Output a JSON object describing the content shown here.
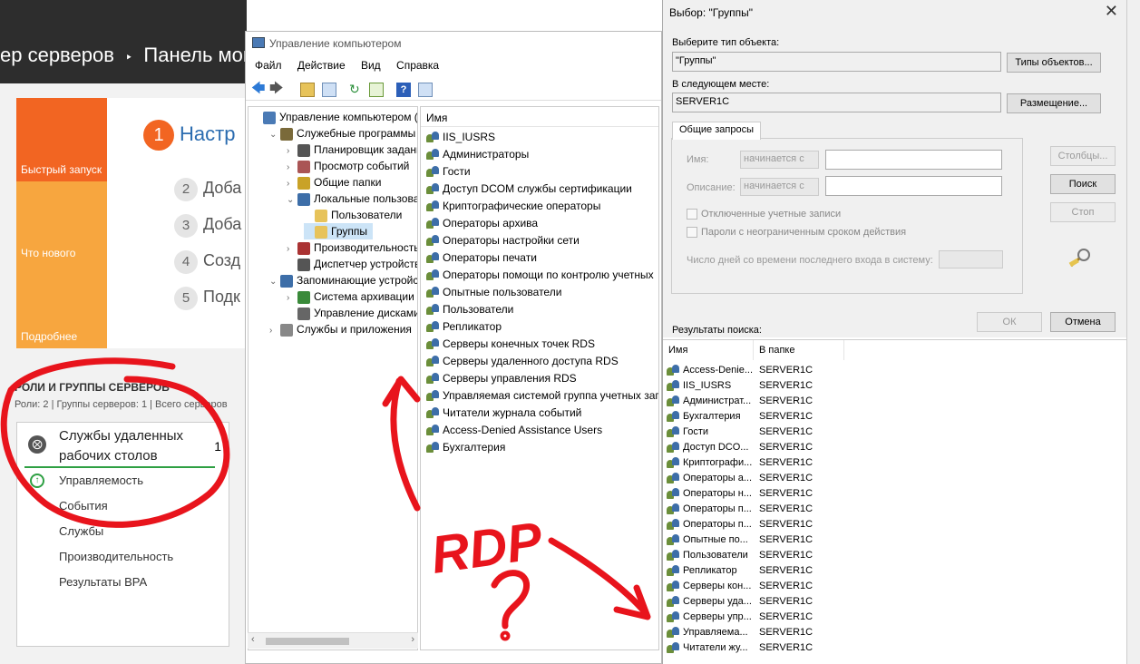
{
  "server_manager": {
    "breadcrumb": "ер серверов",
    "breadcrumb_sep": "‣",
    "page": "Панель мон",
    "tiles": [
      "Быстрый запуск",
      "Что нового",
      "Подробнее"
    ],
    "steps": [
      {
        "num": "1",
        "text": "Настр"
      },
      {
        "num": "2",
        "text": "Доба"
      },
      {
        "num": "3",
        "text": "Доба"
      },
      {
        "num": "4",
        "text": "Созд"
      },
      {
        "num": "5",
        "text": "Подк"
      }
    ],
    "roles_title": "РОЛИ И ГРУППЫ СЕРВЕРОВ",
    "roles_sub": "Роли: 2 | Группы серверов: 1 | Всего серверов",
    "card": {
      "title_line1": "Службы удаленных",
      "title_line2": "рабочих столов",
      "count": "1",
      "items": [
        "Управляемость",
        "События",
        "Службы",
        "Производительность",
        "Результаты BPA"
      ]
    }
  },
  "computer_management": {
    "title": "Управление компьютером",
    "menu": [
      "Файл",
      "Действие",
      "Вид",
      "Справка"
    ],
    "tree": [
      {
        "label": "Управление компьютером (л",
        "indent": 0,
        "exp": ""
      },
      {
        "label": "Служебные программы",
        "indent": 1,
        "exp": "v"
      },
      {
        "label": "Планировщик заданий",
        "indent": 2,
        "exp": ">"
      },
      {
        "label": "Просмотр событий",
        "indent": 2,
        "exp": ">"
      },
      {
        "label": "Общие папки",
        "indent": 2,
        "exp": ">"
      },
      {
        "label": "Локальные пользовате",
        "indent": 2,
        "exp": "v"
      },
      {
        "label": "Пользователи",
        "indent": 3,
        "exp": ""
      },
      {
        "label": "Группы",
        "indent": 3,
        "exp": ""
      },
      {
        "label": "Производительность",
        "indent": 2,
        "exp": ">"
      },
      {
        "label": "Диспетчер устройств",
        "indent": 2,
        "exp": ""
      },
      {
        "label": "Запоминающие устройст",
        "indent": 1,
        "exp": "v"
      },
      {
        "label": "Система архивации да",
        "indent": 2,
        "exp": ">"
      },
      {
        "label": "Управление дисками",
        "indent": 2,
        "exp": ""
      },
      {
        "label": "Службы и приложения",
        "indent": 1,
        "exp": ">"
      }
    ],
    "list_header": "Имя",
    "groups": [
      "IIS_IUSRS",
      "Администраторы",
      "Гости",
      "Доступ DCOM службы сертификации",
      "Криптографические операторы",
      "Операторы архива",
      "Операторы настройки сети",
      "Операторы печати",
      "Операторы помощи по контролю учетных",
      "Опытные пользователи",
      "Пользователи",
      "Репликатор",
      "Серверы конечных точек RDS",
      "Серверы удаленного доступа RDS",
      "Серверы управления RDS",
      "Управляемая системой группа учетных запи",
      "Читатели журнала событий",
      "Access-Denied Assistance Users",
      "Бухгалтерия"
    ]
  },
  "select_dialog": {
    "title": "Выбор: \"Группы\"",
    "object_type_label": "Выберите тип объекта:",
    "object_type_value": "\"Группы\"",
    "object_types_button": "Типы объектов...",
    "location_label": "В следующем месте:",
    "location_value": "SERVER1C",
    "location_button": "Размещение...",
    "tab": "Общие запросы",
    "name_label": "Имя:",
    "desc_label": "Описание:",
    "combo_value": "начинается с",
    "disabled_accounts": "Отключенные учетные записи",
    "nonexpiring_passwords": "Пароли с неограниченным сроком действия",
    "days_label": "Число дней со времени последнего входа в систему:",
    "columns_button": "Столбцы...",
    "search_button": "Поиск",
    "stop_button": "Стоп",
    "ok_button": "ОК",
    "cancel_button": "Отмена",
    "results_label": "Результаты поиска:",
    "col_name": "Имя",
    "col_folder": "В папке",
    "results": [
      {
        "name": "Access-Denie...",
        "folder": "SERVER1C"
      },
      {
        "name": "IIS_IUSRS",
        "folder": "SERVER1C"
      },
      {
        "name": "Администрат...",
        "folder": "SERVER1C"
      },
      {
        "name": "Бухгалтерия",
        "folder": "SERVER1C"
      },
      {
        "name": "Гости",
        "folder": "SERVER1C"
      },
      {
        "name": "Доступ DCO...",
        "folder": "SERVER1C"
      },
      {
        "name": "Криптографи...",
        "folder": "SERVER1C"
      },
      {
        "name": "Операторы а...",
        "folder": "SERVER1C"
      },
      {
        "name": "Операторы н...",
        "folder": "SERVER1C"
      },
      {
        "name": "Операторы п...",
        "folder": "SERVER1C"
      },
      {
        "name": "Операторы п...",
        "folder": "SERVER1C"
      },
      {
        "name": "Опытные по...",
        "folder": "SERVER1C"
      },
      {
        "name": "Пользователи",
        "folder": "SERVER1C"
      },
      {
        "name": "Репликатор",
        "folder": "SERVER1C"
      },
      {
        "name": "Серверы кон...",
        "folder": "SERVER1C"
      },
      {
        "name": "Серверы уда...",
        "folder": "SERVER1C"
      },
      {
        "name": "Серверы упр...",
        "folder": "SERVER1C"
      },
      {
        "name": "Управляема...",
        "folder": "SERVER1C"
      },
      {
        "name": "Читатели жу...",
        "folder": "SERVER1C"
      }
    ]
  },
  "annotation": {
    "text": "RDP",
    "question": "?",
    "color": "#e8141c"
  },
  "colors": {
    "tile_dark": "#f26522",
    "tile_light": "#f7a63f",
    "accent_green": "#2ea043"
  }
}
